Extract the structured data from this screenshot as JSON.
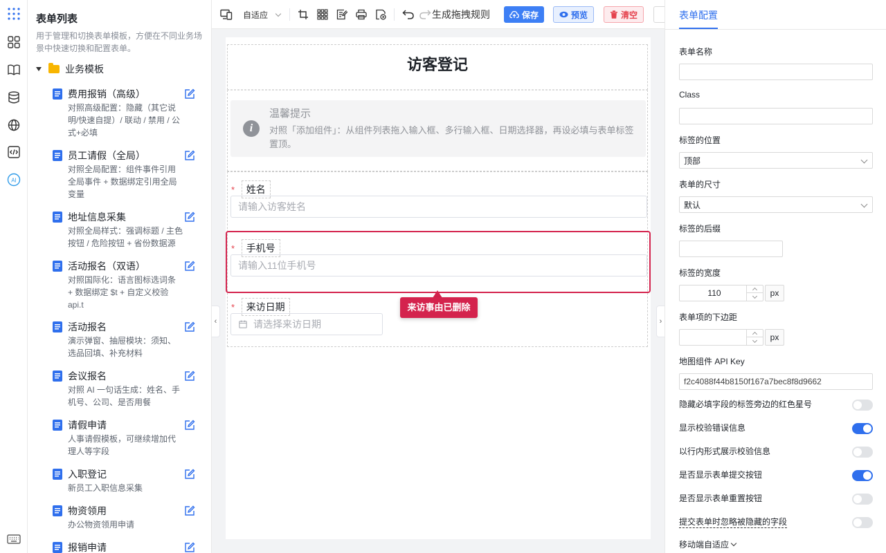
{
  "rail": {
    "icons": [
      "apps-icon",
      "grid-icon",
      "book-icon",
      "database-icon",
      "globe-icon",
      "code-icon",
      "ai-icon",
      "keyboard-icon"
    ],
    "ai_label": "AI"
  },
  "sidebar": {
    "title": "表单列表",
    "desc": "用于管理和切换表单模板，方便在不同业务场景中快速切换和配置表单。",
    "folder": "业务模板",
    "templates": [
      {
        "name": "费用报销（高级）",
        "desc": "对照高级配置：隐藏（其它说明/快速自提）/ 联动 / 禁用 / 公式+必填"
      },
      {
        "name": "员工请假（全局）",
        "desc": "对照全局配置：组件事件引用全局事件 + 数据绑定引用全局变量"
      },
      {
        "name": "地址信息采集",
        "desc": "对照全局样式：强调标题 / 主色按钮 / 危险按钮 + 省份数据源"
      },
      {
        "name": "活动报名（双语）",
        "desc": "对照国际化：语言图标选词条 + 数据绑定 $t + 自定义校验 api.t"
      },
      {
        "name": "活动报名",
        "desc": "演示弹窗、抽屉模块：须知、选品回填、补充材料"
      },
      {
        "name": "会议报名",
        "desc": "对照 AI 一句话生成：姓名、手机号、公司、是否用餐"
      },
      {
        "name": "请假申请",
        "desc": "人事请假模板，可继续增加代理人等字段"
      },
      {
        "name": "入职登记",
        "desc": "新员工入职信息采集"
      },
      {
        "name": "物资领用",
        "desc": "办公物资领用申请"
      },
      {
        "name": "报销申请",
        "desc": ""
      }
    ]
  },
  "toolbar": {
    "mode": "自适应",
    "rules_label": "生成拖拽规则",
    "save": "保存",
    "preview": "预览",
    "clear": "清空"
  },
  "form": {
    "title": "访客登记",
    "tip_title": "温馨提示",
    "tip_body": "对照「添加组件」：从组件列表拖入输入框、多行输入框、日期选择器，再设必填与表单标签置顶。",
    "required_mark": "*",
    "fields": [
      {
        "label": "姓名",
        "placeholder": "请输入访客姓名"
      },
      {
        "label": "手机号",
        "placeholder": "请输入11位手机号"
      },
      {
        "label": "来访日期",
        "placeholder": "请选择来访日期"
      }
    ],
    "callout": "来访事由已删除"
  },
  "panel": {
    "tab": "表单配置",
    "form_name_label": "表单名称",
    "form_name_value": "",
    "class_label": "Class",
    "class_value": "",
    "label_position_label": "标签的位置",
    "label_position_value": "顶部",
    "size_label": "表单的尺寸",
    "size_value": "默认",
    "suffix_label": "标签的后缀",
    "suffix_value": "",
    "label_width_label": "标签的宽度",
    "label_width_value": "110",
    "unit": "px",
    "margin_label": "表单项的下边距",
    "margin_value": "",
    "apikey_label": "地图组件 API Key",
    "apikey_value": "f2c4088f44b8150f167a7bec8f8d9662",
    "switches": [
      {
        "label": "隐藏必填字段的标签旁边的红色星号",
        "on": false
      },
      {
        "label": "显示校验错误信息",
        "on": true
      },
      {
        "label": "以行内形式展示校验信息",
        "on": false
      },
      {
        "label": "是否显示表单提交按钮",
        "on": true
      },
      {
        "label": "是否显示表单重置按钮",
        "on": false
      },
      {
        "label": "提交表单时忽略被隐藏的字段",
        "on": false
      }
    ],
    "mobile_label": "移动端自适应"
  },
  "colors": {
    "primary": "#2f6fed",
    "danger": "#d4234d",
    "border": "#e8e8e8"
  }
}
